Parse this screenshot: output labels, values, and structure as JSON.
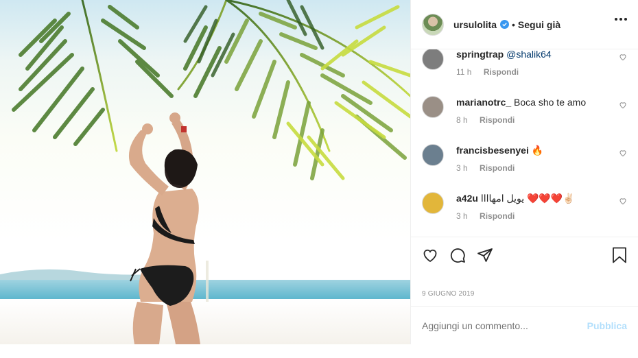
{
  "post": {
    "username": "ursulolita",
    "separator": "•",
    "follow_label": "Segui già",
    "date": "9 GIUGNO 2019"
  },
  "comments": [
    {
      "user": "springtrap",
      "text": "",
      "mention": "@shalik64",
      "time": "11 h",
      "reply": "Rispondi",
      "avatar_color": "#7a7a7a"
    },
    {
      "user": "marianotrc_",
      "text": "Boca sho te amo",
      "mention": "",
      "time": "8 h",
      "reply": "Rispondi",
      "avatar_color": "#9a8f86"
    },
    {
      "user": "francisbesenyei",
      "text": "🔥",
      "mention": "",
      "time": "3 h",
      "reply": "Rispondi",
      "avatar_color": "#6b7f8f"
    },
    {
      "user": "a42u",
      "text": "يويل امهاااا ❤️❤️❤️✌🏻",
      "mention": "",
      "time": "3 h",
      "reply": "Rispondi",
      "avatar_color": "#e2b63a"
    }
  ],
  "add_comment": {
    "placeholder": "Aggiungi un commento...",
    "post_label": "Pubblica"
  },
  "icons": [
    "verified-icon",
    "more-icon",
    "like-icon",
    "comment-icon",
    "share-icon",
    "save-icon",
    "heart-icon"
  ],
  "colors": {
    "verified": "#3897f0",
    "link": "#00376b",
    "muted": "#8e8e8e",
    "post_disabled": "#b2dffc"
  }
}
